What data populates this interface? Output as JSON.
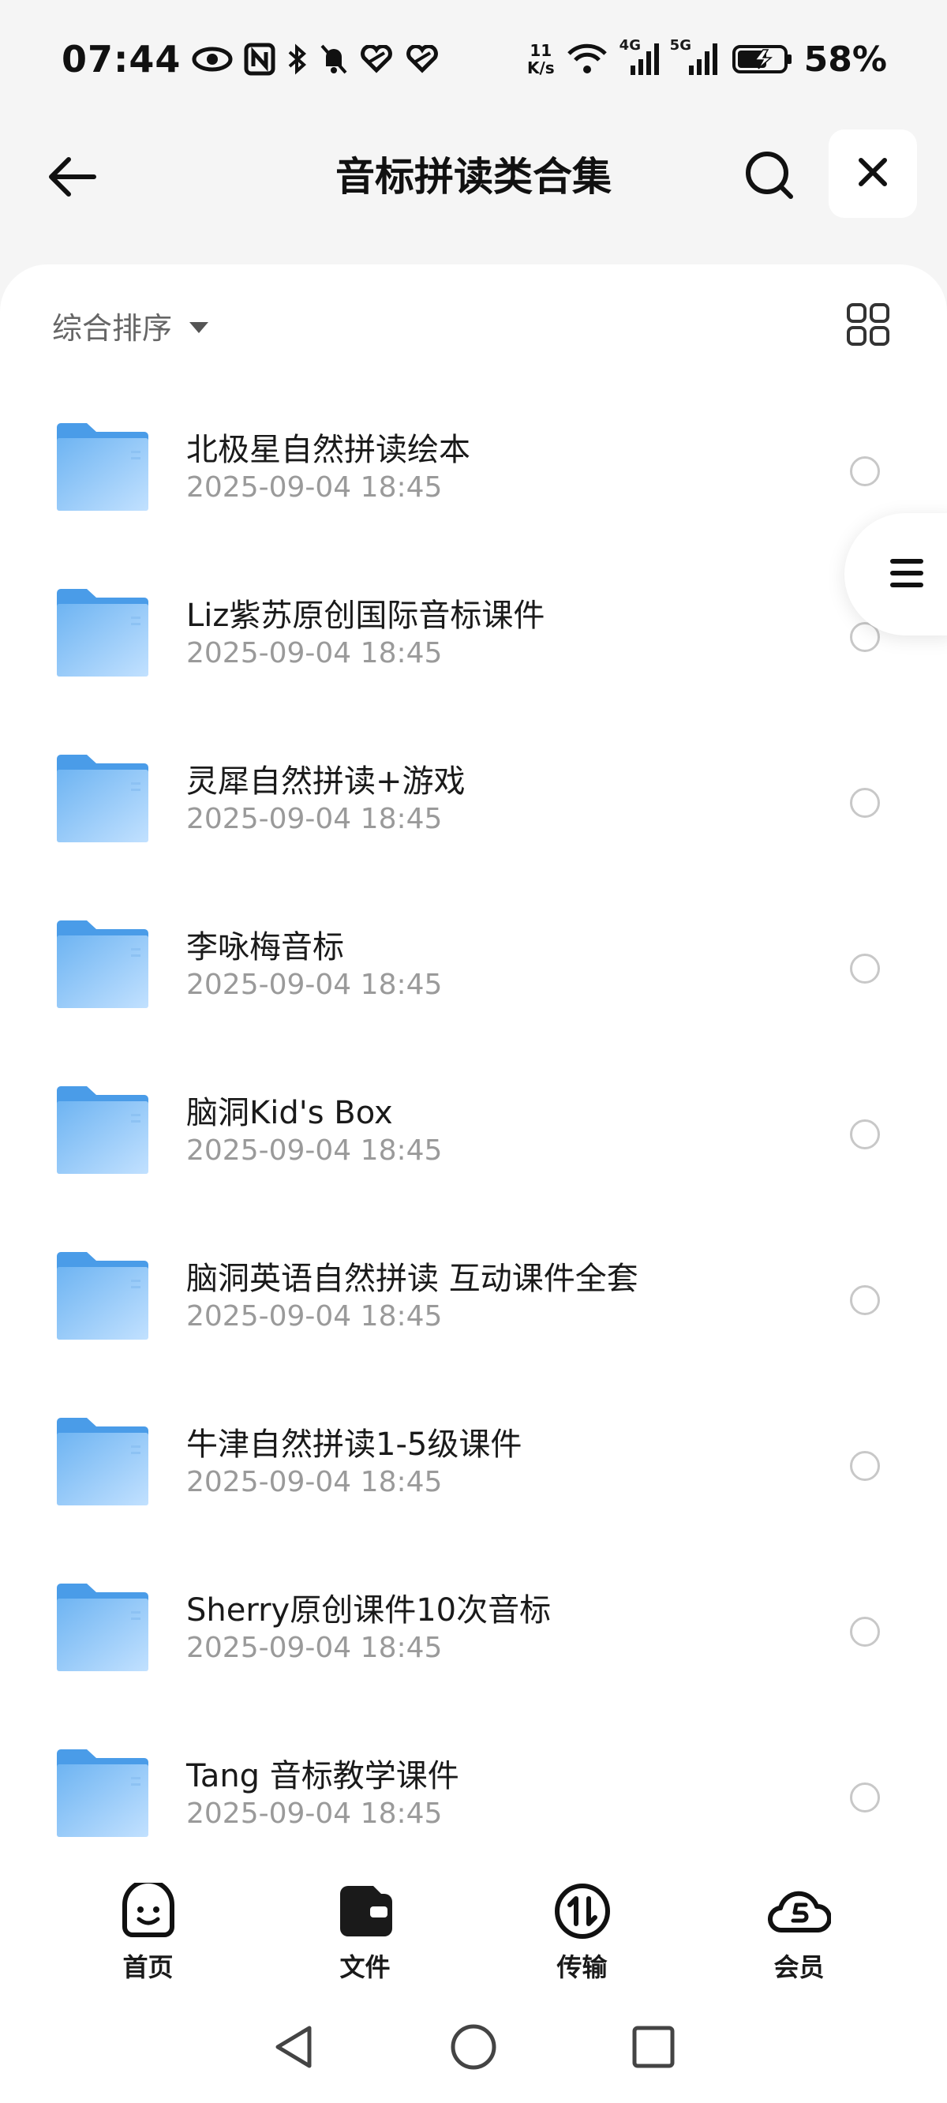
{
  "status_bar": {
    "time": "07:44",
    "net_speed_value": "11",
    "net_speed_unit": "K/s",
    "network_4g": "4G",
    "network_5g": "5G",
    "battery": "58%",
    "icons": [
      "eye-icon",
      "nfc-icon",
      "bluetooth-icon",
      "bell-off-icon",
      "heart-sync-icon",
      "heart-sync-icon",
      "wifi-icon",
      "signal-icon",
      "battery-charging-icon"
    ]
  },
  "header": {
    "title": "音标拼读类合集",
    "back_icon": "arrow-left-icon",
    "search_icon": "search-icon",
    "close_icon": "close-icon"
  },
  "toolbar": {
    "sort_label": "综合排序",
    "grid_icon": "grid-view-icon"
  },
  "files": [
    {
      "name": "北极星自然拼读绘本",
      "date": "2025-09-04 18:45"
    },
    {
      "name": "Liz紫苏原创国际音标课件",
      "date": "2025-09-04 18:45"
    },
    {
      "name": "灵犀自然拼读+游戏",
      "date": "2025-09-04 18:45"
    },
    {
      "name": "李咏梅音标",
      "date": "2025-09-04 18:45"
    },
    {
      "name": "脑洞Kid's Box",
      "date": "2025-09-04 18:45"
    },
    {
      "name": "脑洞英语自然拼读 互动课件全套",
      "date": "2025-09-04 18:45"
    },
    {
      "name": "牛津自然拼读1-5级课件",
      "date": "2025-09-04 18:45"
    },
    {
      "name": "Sherry原创课件10次音标",
      "date": "2025-09-04 18:45"
    },
    {
      "name": "Tang 音标教学课件",
      "date": "2025-09-04 18:45"
    }
  ],
  "bottom_nav": [
    {
      "label": "首页",
      "icon": "smiley-home-icon"
    },
    {
      "label": "文件",
      "icon": "wallet-folder-icon"
    },
    {
      "label": "传输",
      "icon": "transfer-icon"
    },
    {
      "label": "会员",
      "icon": "cloud-vip-icon"
    }
  ],
  "colors": {
    "folder_light": "#bfe0ff",
    "folder_dark": "#5aa8ee",
    "text_primary": "#1a1a1a",
    "text_secondary": "#9a9a9a"
  }
}
